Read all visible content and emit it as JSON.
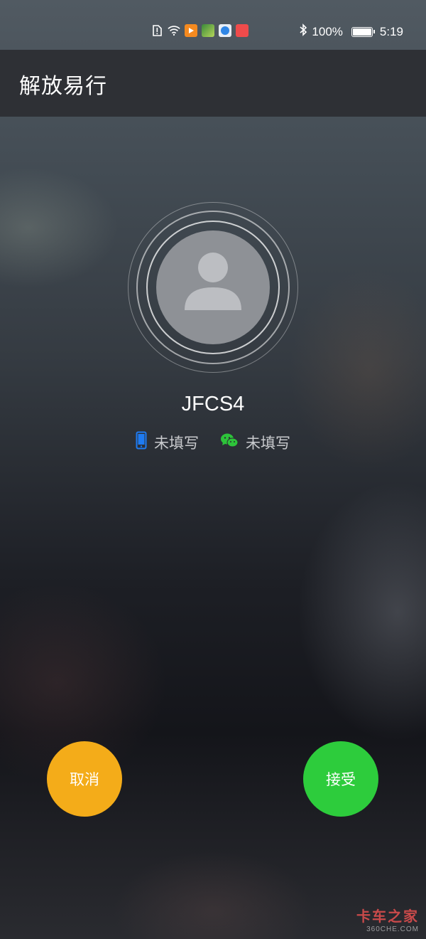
{
  "status_bar": {
    "battery_percent": "100%",
    "time": "5:19",
    "icons": [
      "sim-alert-icon",
      "wifi-icon",
      "video-app-icon",
      "game-app-icon",
      "browser-app-icon",
      "shopping-app-icon",
      "bluetooth-icon",
      "battery-charging-icon"
    ]
  },
  "app_bar": {
    "title": "解放易行"
  },
  "caller": {
    "name": "JFCS4",
    "phone_label": "未填写",
    "wechat_label": "未填写"
  },
  "actions": {
    "cancel_label": "取消",
    "accept_label": "接受"
  },
  "watermark": {
    "main": "卡车之家",
    "sub": "360CHE.COM"
  },
  "colors": {
    "cancel": "#f4ac19",
    "accept": "#2dcc3c",
    "phone_icon": "#1e7bf2",
    "wechat_icon": "#2dc43a",
    "app_bar": "#2e3035"
  }
}
